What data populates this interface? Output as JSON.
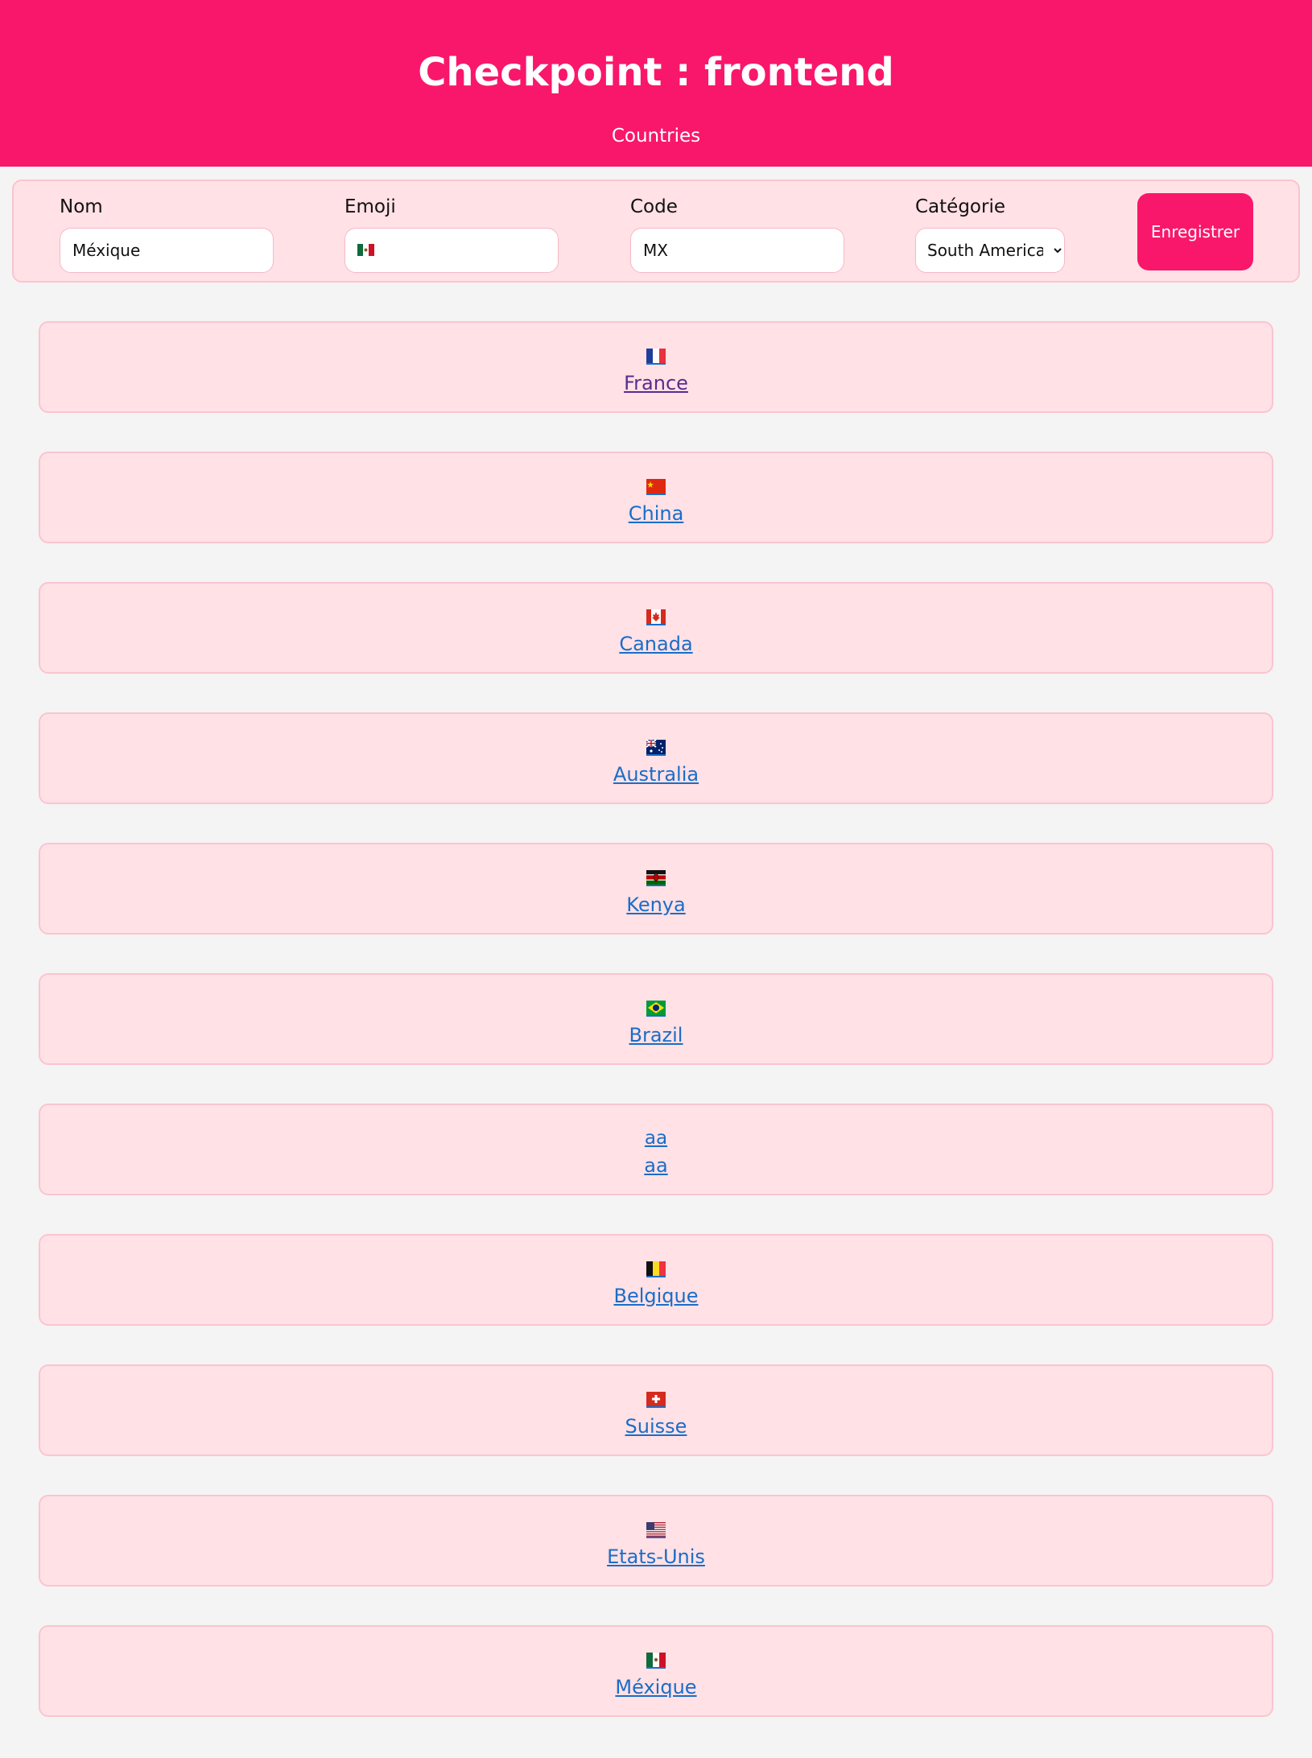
{
  "header": {
    "title": "Checkpoint : frontend",
    "nav_link": "Countries",
    "background_color": "#f9176b"
  },
  "form": {
    "name_label": "Nom",
    "name_value": "Méxique",
    "emoji_label": "Emoji",
    "emoji_value": "mexico-flag-icon",
    "code_label": "Code",
    "code_value": "MX",
    "category_label": "Catégorie",
    "category_selected": "South America",
    "save_label": "Enregistrer"
  },
  "countries": [
    {
      "emoji": "france-flag-icon",
      "name": "France"
    },
    {
      "emoji": "china-flag-icon",
      "name": "China"
    },
    {
      "emoji": "canada-flag-icon",
      "name": "Canada"
    },
    {
      "emoji": "australia-flag-icon",
      "name": "Australia"
    },
    {
      "emoji": "kenya-flag-icon",
      "name": "Kenya"
    },
    {
      "emoji": "brazil-flag-icon",
      "name": "Brazil"
    },
    {
      "emoji_text": "aa",
      "name": "aa"
    },
    {
      "emoji": "belgium-flag-icon",
      "name": "Belgique"
    },
    {
      "emoji": "switzerland-flag-icon",
      "name": "Suisse"
    },
    {
      "emoji": "usa-flag-icon",
      "name": "Etats-Unis"
    },
    {
      "emoji": "mexico-flag-icon",
      "name": "Méxique"
    }
  ],
  "colors": {
    "accent": "#f9176b",
    "card_background": "#ffe1e6",
    "link": "#1b6dc7",
    "visited_link": "#5b2b8f"
  }
}
